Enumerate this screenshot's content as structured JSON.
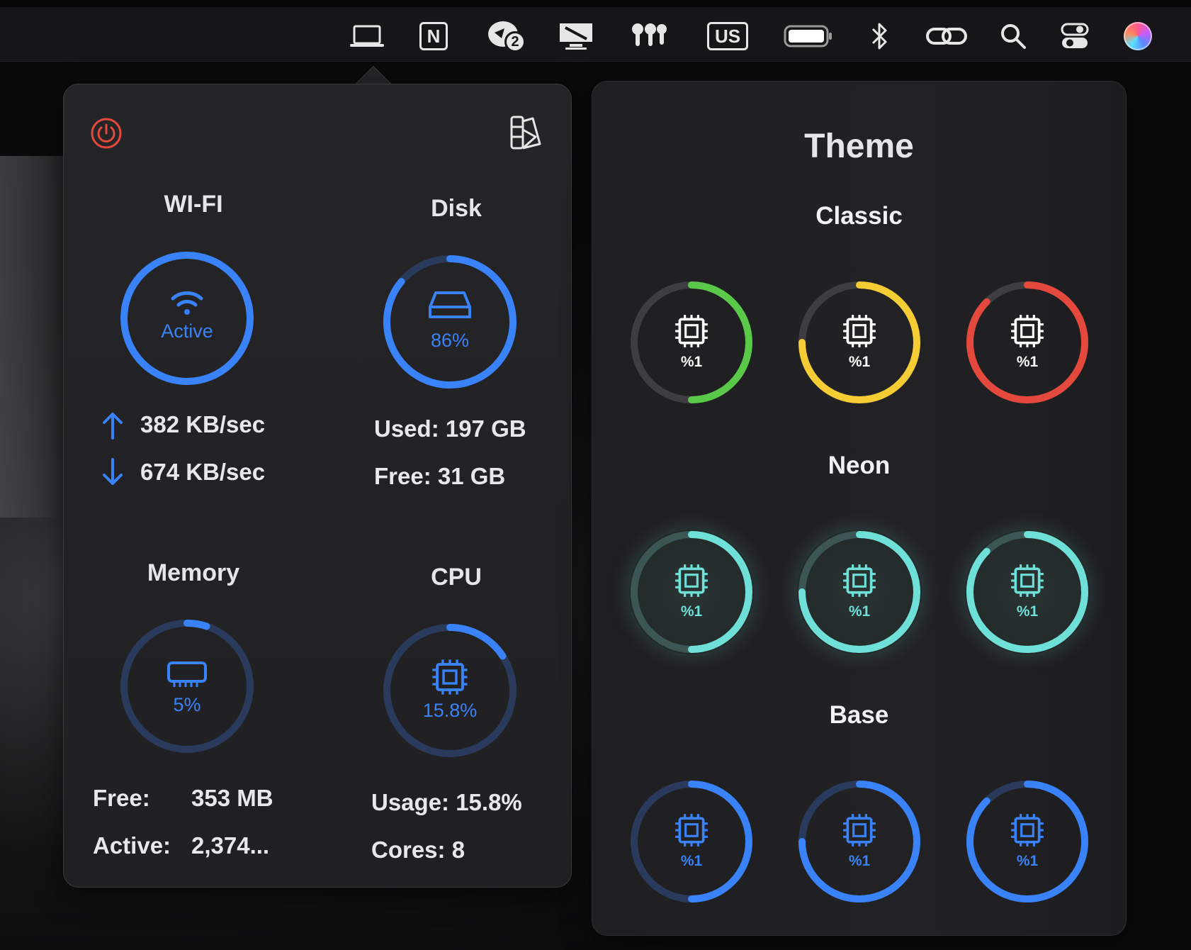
{
  "menubar": {
    "input_source_label": "US",
    "notion_label": "N",
    "notification_count": "2"
  },
  "popover": {
    "wifi": {
      "title": "WI-FI",
      "status": "Active",
      "upload": "382 KB/sec",
      "download": "674 KB/sec"
    },
    "disk": {
      "title": "Disk",
      "percent_label": "86%",
      "percent": 86,
      "used": "Used: 197 GB",
      "free": "Free: 31 GB"
    },
    "memory": {
      "title": "Memory",
      "percent_label": "5%",
      "percent": 5,
      "free_label": "Free:",
      "free_value": "353 MB",
      "active_label": "Active:",
      "active_value": "2,374..."
    },
    "cpu": {
      "title": "CPU",
      "percent_label": "15.8%",
      "percent": 15.8,
      "usage": "Usage: 15.8%",
      "cores": "Cores: 8"
    }
  },
  "theme": {
    "title": "Theme",
    "groups": [
      {
        "name": "Classic",
        "items": [
          {
            "label": "%1",
            "color": "#5ac94a",
            "fraction": 0.5
          },
          {
            "label": "%1",
            "color": "#f5cc33",
            "fraction": 0.75
          },
          {
            "label": "%1",
            "color": "#e5483c",
            "fraction": 0.875
          }
        ]
      },
      {
        "name": "Neon",
        "items": [
          {
            "label": "%1",
            "color": "#6fe0d8",
            "fraction": 0.5
          },
          {
            "label": "%1",
            "color": "#6fe0d8",
            "fraction": 0.75
          },
          {
            "label": "%1",
            "color": "#6fe0d8",
            "fraction": 0.875
          }
        ]
      },
      {
        "name": "Base",
        "items": [
          {
            "label": "%1",
            "color": "#3a82f7",
            "fraction": 0.5
          },
          {
            "label": "%1",
            "color": "#3a82f7",
            "fraction": 0.75
          },
          {
            "label": "%1",
            "color": "#3a82f7",
            "fraction": 0.875
          }
        ]
      }
    ]
  },
  "colors": {
    "accent": "#3a82f7",
    "power": "#e5483c",
    "track_dark": "#2a3a5c"
  }
}
